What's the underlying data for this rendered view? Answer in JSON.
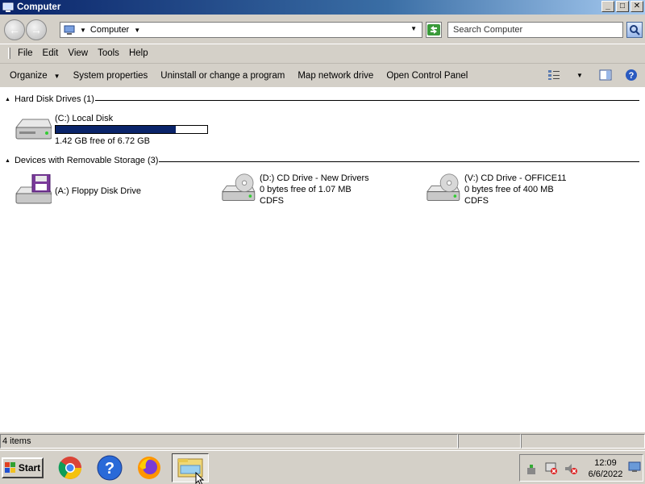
{
  "window": {
    "title": "Computer"
  },
  "address": {
    "crumb": "Computer",
    "search_placeholder": "Search Computer"
  },
  "menu": [
    {
      "label": "File"
    },
    {
      "label": "Edit"
    },
    {
      "label": "View"
    },
    {
      "label": "Tools"
    },
    {
      "label": "Help"
    }
  ],
  "commands": {
    "organize": "Organize",
    "system_properties": "System properties",
    "uninstall": "Uninstall or change a program",
    "map_drive": "Map network drive",
    "control_panel": "Open Control Panel"
  },
  "groups": {
    "hard_disk": {
      "label": "Hard Disk Drives (1)"
    },
    "removable": {
      "label": "Devices with Removable Storage (3)"
    }
  },
  "drives": {
    "c": {
      "name": "(C:) Local Disk",
      "free": "1.42 GB free of 6.72 GB",
      "used_fraction": 0.79
    },
    "a": {
      "name": "(A:) Floppy Disk Drive"
    },
    "d": {
      "name": "(D:) CD Drive - New Drivers",
      "free": "0 bytes free of 1.07 MB",
      "fs": "CDFS"
    },
    "v": {
      "name": "(V:) CD Drive - OFFICE11",
      "free": "0 bytes free of 400 MB",
      "fs": "CDFS"
    }
  },
  "status": {
    "items": "4 items"
  },
  "taskbar": {
    "start_label": "Start",
    "apps": [
      "chrome-icon",
      "help-icon",
      "firefox-icon",
      "explorer-icon"
    ],
    "clock_time": "12:09",
    "clock_date": "6/6/2022"
  }
}
